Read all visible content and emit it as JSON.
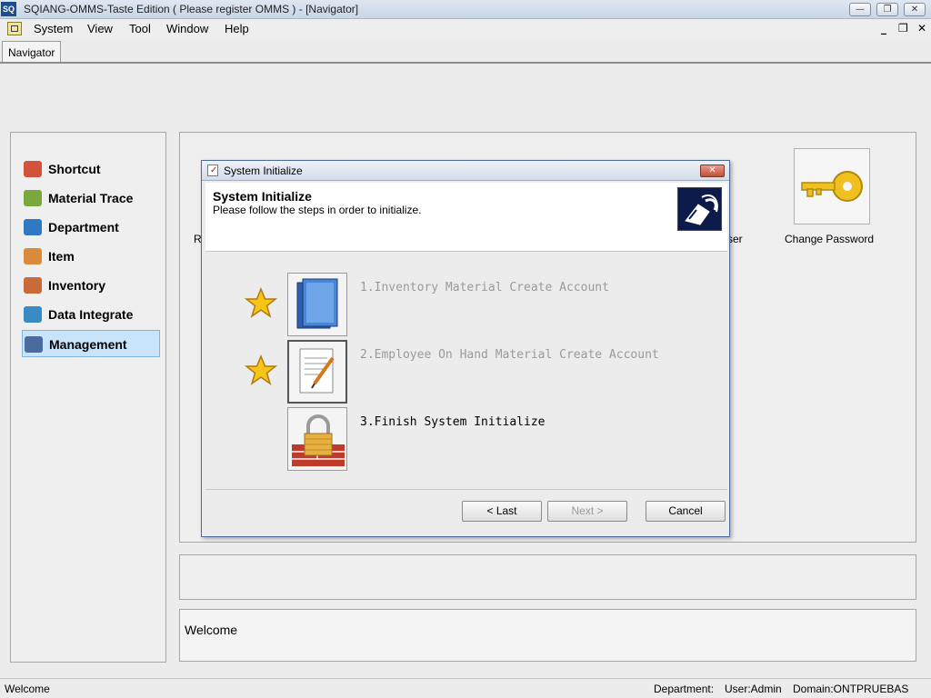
{
  "window": {
    "app_icon_label": "SQ",
    "title": "SQIANG-OMMS-Taste Edition ( Please register OMMS ) - [Navigator]",
    "min_glyph": "—",
    "max_glyph": "❐",
    "close_glyph": "✕"
  },
  "menu": {
    "items": [
      "System",
      "View",
      "Tool",
      "Window",
      "Help"
    ],
    "mdi_min": "_",
    "mdi_restore": "❐",
    "mdi_close": "✕"
  },
  "tabs": [
    {
      "label": "Navigator"
    }
  ],
  "nav": {
    "items": [
      {
        "label": "Shortcut",
        "icon": "house-icon",
        "color": "#d2523a"
      },
      {
        "label": "Material Trace",
        "icon": "pencil-icon",
        "color": "#7aa83c"
      },
      {
        "label": "Department",
        "icon": "building-icon",
        "color": "#2f78c4"
      },
      {
        "label": "Item",
        "icon": "boxes-icon",
        "color": "#d98a3a"
      },
      {
        "label": "Inventory",
        "icon": "warehouse-icon",
        "color": "#c86a3a"
      },
      {
        "label": "Data Integrate",
        "icon": "database-icon",
        "color": "#3a8ac4"
      },
      {
        "label": "Management",
        "icon": "tools-icon",
        "color": "#4a6aa0"
      }
    ],
    "selected": "Management"
  },
  "tiles": {
    "change_password": "Change Password",
    "partial_left": "R",
    "partial_right": "ser"
  },
  "welcome": "Welcome",
  "dialog": {
    "title": "System Initialize",
    "close_glyph": "✕",
    "title_check": "✓",
    "header_title": "System Initialize",
    "header_sub": "Please follow the steps in order to initialize.",
    "steps": [
      {
        "label": "1.Inventory Material Create Account",
        "state": "done",
        "icon": "books-icon"
      },
      {
        "label": "2.Employee On Hand Material Create Account",
        "state": "done",
        "icon": "document-edit-icon"
      },
      {
        "label": "3.Finish System Initialize",
        "state": "active",
        "icon": "lock-wall-icon"
      }
    ],
    "buttons": {
      "last": "< Last",
      "next": "Next >",
      "cancel": "Cancel"
    }
  },
  "status": {
    "left": "Welcome",
    "department": "Department:",
    "user": "User:Admin",
    "domain": "Domain:ONTPRUEBAS"
  }
}
